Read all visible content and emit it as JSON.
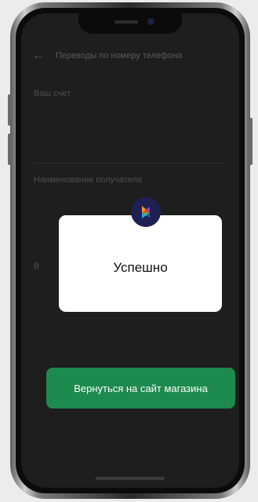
{
  "app": {
    "header_title": "Переводы по номеру телефона",
    "fields": [
      {
        "label": "Ваш счет",
        "value": ""
      },
      {
        "label": "Наименование получателя",
        "value": ""
      },
      {
        "label": "В",
        "value": ""
      }
    ]
  },
  "modal": {
    "title": "Успешно",
    "logo_icon": "sbp-logo-icon"
  },
  "actions": {
    "return_label": "Вернуться на сайт магазина"
  },
  "colors": {
    "screen_bg": "#1e1e1e",
    "modal_bg": "#ffffff",
    "button_bg": "#1d8a4e",
    "logo_bg": "#1f2054"
  }
}
